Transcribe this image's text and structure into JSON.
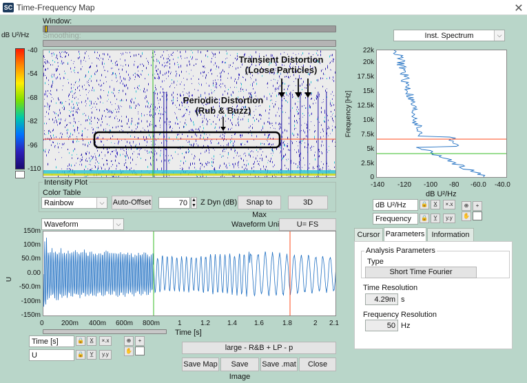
{
  "window": {
    "title": "Time-Frequency Map",
    "app_icon": "SC"
  },
  "sliders": {
    "window_label": "Window:",
    "smoothing_label": "Smoothing:"
  },
  "colorbar": {
    "unit": "dB U²/Hz",
    "ticks": [
      "-40",
      "-54",
      "-68",
      "-82",
      "-96",
      "-110"
    ],
    "colors": [
      "#ff1a00",
      "#ff8c00",
      "#ffee00",
      "#7de000",
      "#00c9a8",
      "#0072ff",
      "#2c1fb8",
      "#1a0a6e"
    ]
  },
  "spectrogram": {
    "annotation_transient": [
      "Transient Distortion",
      "(Loose Particles)"
    ],
    "annotation_periodic": [
      "Periodic Distortion",
      "(Rub & Buzz)"
    ]
  },
  "intensity": {
    "group_label": "Intensity Plot",
    "color_table_label": "Color Table",
    "color_table_value": "Rainbow",
    "auto_offset": "Auto-Offset",
    "zdyn_value": "70",
    "zdyn_label": "Z Dyn (dB)",
    "snap_to_max": "Snap to Max",
    "btn_3d": "3D"
  },
  "waveform": {
    "selector": "Waveform",
    "unit_label": "Waveform Unit",
    "unit_value": "U= FS",
    "y_axis_label": "U",
    "x_axis_label": "Time [s]",
    "y_ticks": [
      "150m",
      "100m",
      "50.0m",
      "0.00",
      "-50.0m",
      "-100m",
      "-150m"
    ],
    "x_ticks": [
      "0",
      "200m",
      "400m",
      "600m",
      "800m",
      "1",
      "1.2",
      "1.4",
      "1.6",
      "1.8",
      "2",
      "2.1"
    ],
    "x_field": "Time [s]",
    "y_field": "U",
    "info_bar": "large - R&B + LP - p"
  },
  "buttons": {
    "save_map": "Save Map",
    "save_image": "Save Image",
    "save_mat": "Save .mat",
    "close": "Close"
  },
  "spectrum": {
    "selector": "Inst. Spectrum",
    "y_label": "Frequency [Hz]",
    "x_label": "dB U²/Hz",
    "y_ticks": [
      "22k",
      "20k",
      "17.5k",
      "15k",
      "12.5k",
      "10k",
      "7.5k",
      "5k",
      "2.5k",
      "0"
    ],
    "x_ticks": [
      "-140",
      "-120",
      "-100",
      "-80",
      "-60.0",
      "-40.0"
    ],
    "x_field": "dB U²/Hz",
    "y_field": "Frequency"
  },
  "tool_icons": {
    "lock": "🔒",
    "xlabel": "X̲",
    "xzoom": "×.x"
  },
  "tabs": [
    "Cursor",
    "Parameters",
    "Information"
  ],
  "params": {
    "group_label": "Analysis Parameters",
    "type_label": "Type",
    "type_value": "Short Time Fourier",
    "time_res_label": "Time Resolution",
    "time_res_value": "4.29m",
    "time_res_unit": "s",
    "freq_res_label": "Frequency Resolution",
    "freq_res_value": "50",
    "freq_res_unit": "Hz"
  }
}
